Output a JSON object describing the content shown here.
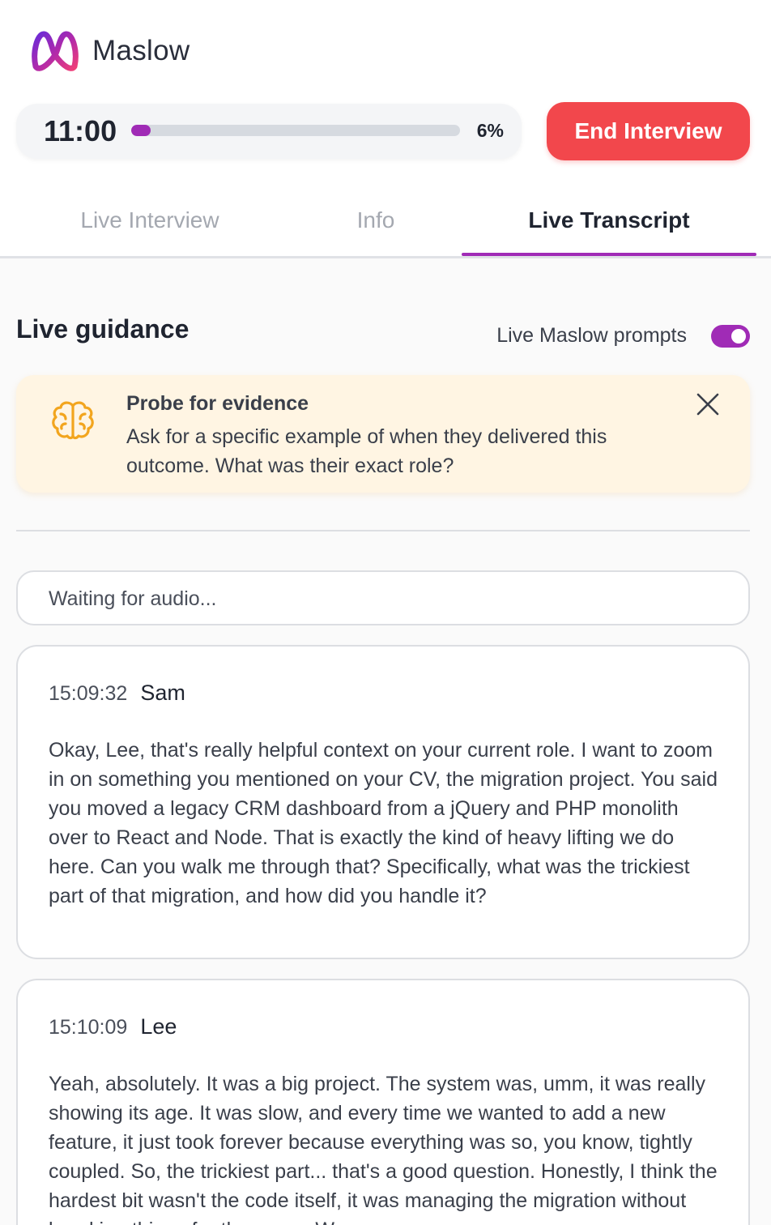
{
  "brand": {
    "name": "Maslow",
    "accent": "#a02bb6",
    "danger": "#f2474c"
  },
  "session": {
    "timer": "11:00",
    "progress_percent": 6,
    "progress_label": "6%",
    "end_button": "End Interview"
  },
  "tabs": [
    {
      "label": "Live Interview",
      "active": false
    },
    {
      "label": "Info",
      "active": false
    },
    {
      "label": "Live Transcript",
      "active": true
    }
  ],
  "guidance": {
    "title": "Live guidance",
    "prompts_label": "Live Maslow prompts",
    "prompts_enabled": true,
    "prompt": {
      "icon": "brain-icon",
      "title": "Probe for evidence",
      "body": "Ask for a specific example of when they delivered this outcome. What was their exact role?"
    }
  },
  "transcript": {
    "status": "Waiting for audio...",
    "messages": [
      {
        "time": "15:09:32",
        "speaker": "Sam",
        "text": "Okay, Lee, that's really helpful context on your current role. I want to zoom in on something you mentioned on your CV, the migration project. You said you moved a legacy CRM dashboard from a jQuery and PHP monolith over to React and Node. That is exactly the kind of heavy lifting we do here. Can you walk me through that? Specifically, what was the trickiest part of that migration, and how did you handle it?"
      },
      {
        "time": "15:10:09",
        "speaker": "Lee",
        "text": "Yeah, absolutely. It was a big project. The system was, umm, it was really showing its age. It was slow, and every time we wanted to add a new feature, it just took forever because everything was so, you know, tightly coupled. So, the trickiest part... that's a good question. Honestly, I think the hardest bit wasn't the code itself, it was managing the migration without breaking things for the users. We"
      }
    ]
  }
}
